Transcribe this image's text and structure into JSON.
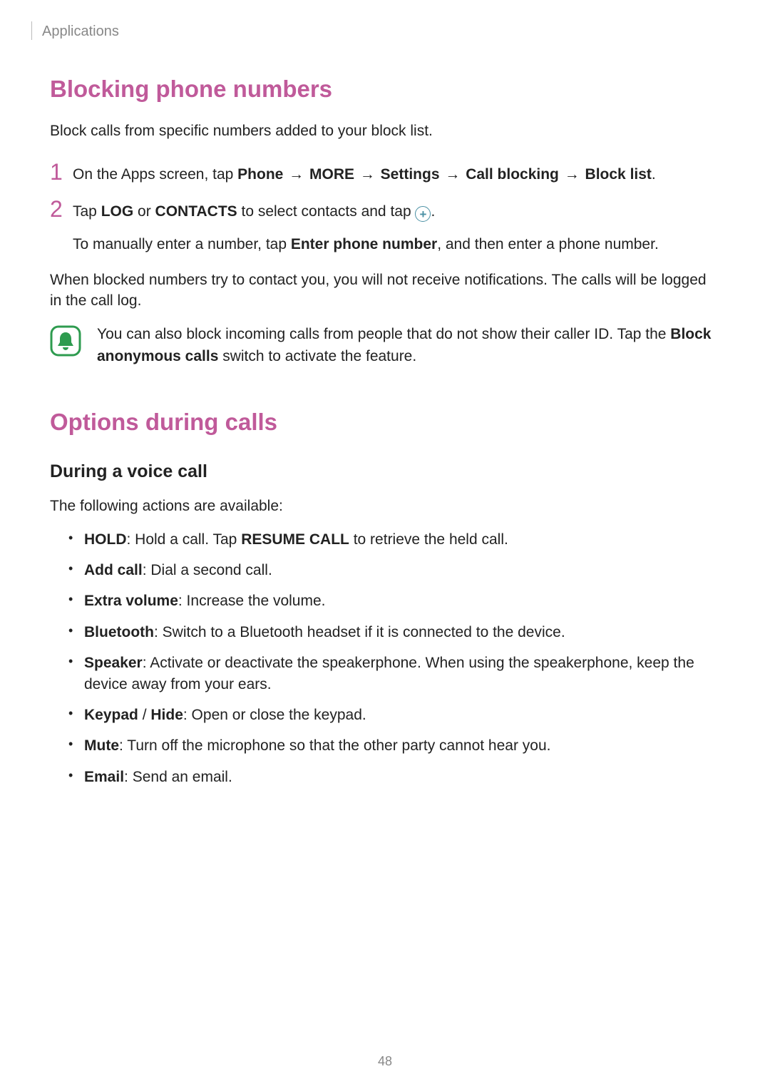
{
  "breadcrumb": "Applications",
  "section1": {
    "title": "Blocking phone numbers",
    "intro": "Block calls from specific numbers added to your block list.",
    "step1": {
      "num": "1",
      "pre": "On the Apps screen, tap ",
      "path": [
        "Phone",
        "MORE",
        "Settings",
        "Call blocking",
        "Block list"
      ],
      "arrow": " → "
    },
    "step2": {
      "num": "2",
      "t1": "Tap ",
      "b1": "LOG",
      "t2": " or ",
      "b2": "CONTACTS",
      "t3": " to select contacts and tap ",
      "t4": ".",
      "sub_t1": "To manually enter a number, tap ",
      "sub_b1": "Enter phone number",
      "sub_t2": ", and then enter a phone number."
    },
    "after": "When blocked numbers try to contact you, you will not receive notifications. The calls will be logged in the call log.",
    "note_t1": "You can also block incoming calls from people that do not show their caller ID. Tap the ",
    "note_b1": "Block anonymous calls",
    "note_t2": " switch to activate the feature."
  },
  "section2": {
    "title": "Options during calls",
    "sub": "During a voice call",
    "intro": "The following actions are available:",
    "items": [
      {
        "b": "HOLD",
        "t1": ": Hold a call. Tap ",
        "b2": "RESUME CALL",
        "t2": " to retrieve the held call."
      },
      {
        "b": "Add call",
        "t1": ": Dial a second call."
      },
      {
        "b": "Extra volume",
        "t1": ": Increase the volume."
      },
      {
        "b": "Bluetooth",
        "t1": ": Switch to a Bluetooth headset if it is connected to the device."
      },
      {
        "b": "Speaker",
        "t1": ": Activate or deactivate the speakerphone. When using the speakerphone, keep the device away from your ears."
      },
      {
        "b": "Keypad",
        "sep": " / ",
        "b2": "Hide",
        "t1": ": Open or close the keypad."
      },
      {
        "b": "Mute",
        "t1": ": Turn off the microphone so that the other party cannot hear you."
      },
      {
        "b": "Email",
        "t1": ": Send an email."
      }
    ]
  },
  "page_number": "48"
}
